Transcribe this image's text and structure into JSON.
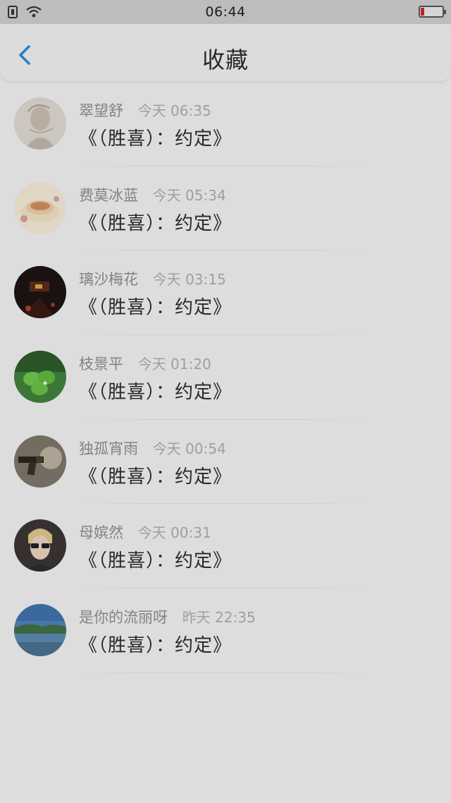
{
  "status_bar": {
    "time": "06:44",
    "battery_color": "#d61f1f"
  },
  "header": {
    "title": "收藏",
    "back_icon": "chevron-left-icon",
    "accent": "#1e88d6"
  },
  "favorites": [
    {
      "name": "翠望舒",
      "time": "今天 06:35",
      "content": "《（胜喜）：约定》",
      "avatar": "sketch-portrait"
    },
    {
      "name": "费莫冰蓝",
      "time": "今天 05:34",
      "content": "《（胜喜）：约定》",
      "avatar": "teacup"
    },
    {
      "name": "璃沙梅花",
      "time": "今天 03:15",
      "content": "《（胜喜）：约定》",
      "avatar": "dark-scene"
    },
    {
      "name": "枝景平",
      "time": "今天 01:20",
      "content": "《（胜喜）：约定》",
      "avatar": "clover"
    },
    {
      "name": "独孤宵雨",
      "time": "今天 00:54",
      "content": "《（胜喜）：约定》",
      "avatar": "revolver"
    },
    {
      "name": "母嫔然",
      "time": "今天 00:31",
      "content": "《（胜喜）：约定》",
      "avatar": "person-sunglasses"
    },
    {
      "name": "是你的流丽呀",
      "time": "昨天 22:35",
      "content": "《（胜喜）：约定》",
      "avatar": "lake-landscape"
    }
  ]
}
